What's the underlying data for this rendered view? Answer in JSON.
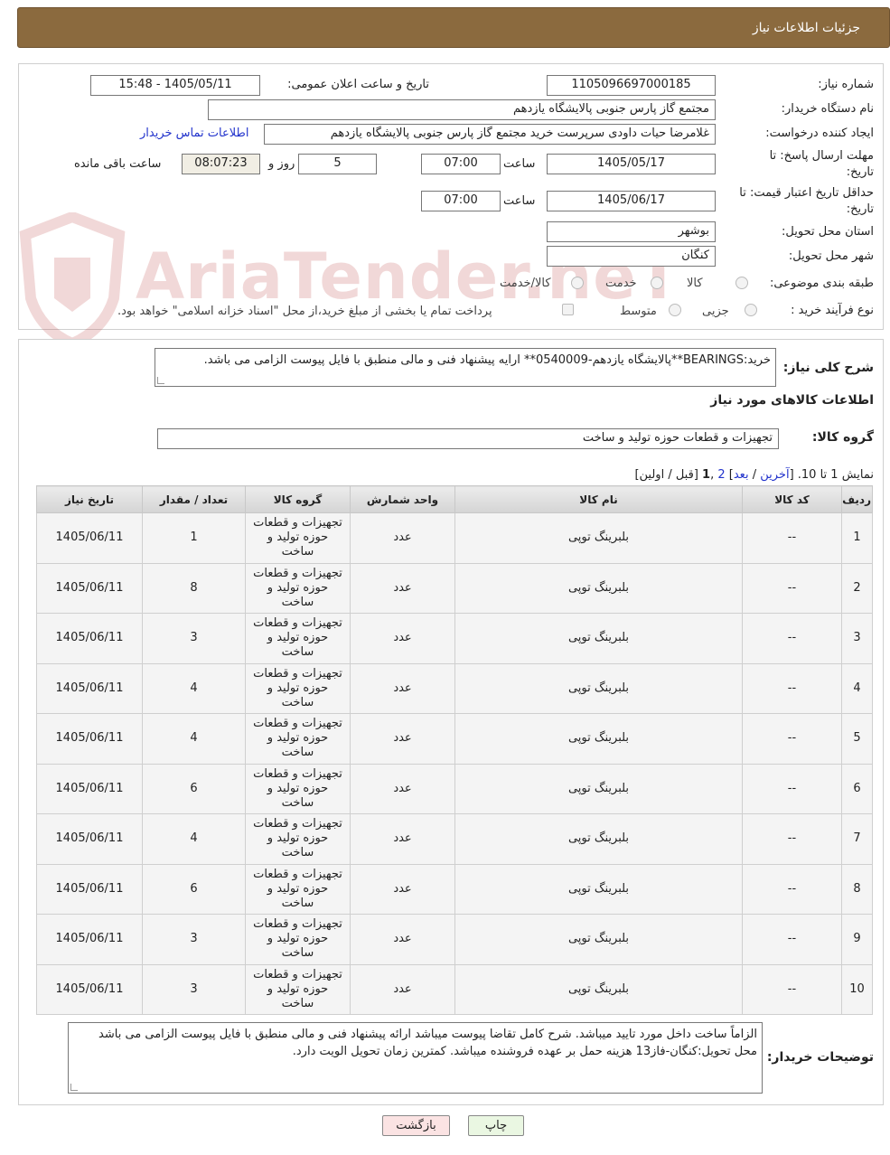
{
  "header": {
    "title": "جزئیات اطلاعات نیاز"
  },
  "general": {
    "need_number_label": "شماره نیاز:",
    "need_number": "1105096697000185",
    "announce_label": "تاریخ و ساعت اعلان عمومی:",
    "announce_value": "1405/05/11 - 15:48",
    "buyer_org_label": "نام دستگاه خریدار:",
    "buyer_org": "مجتمع گاز پارس جنوبی  پالایشگاه یازدهم",
    "requester_label": "ایجاد کننده درخواست:",
    "requester": "غلامرضا حیات داودی سرپرست خرید مجتمع گاز پارس جنوبی  پالایشگاه یازدهم",
    "contact_link": "اطلاعات تماس خریدار",
    "deadline_label_1": "مهلت ارسال پاسخ: تا",
    "deadline_label_2": "تاریخ:",
    "deadline_date": "1405/05/17",
    "time_label": "ساعت",
    "deadline_time": "07:00",
    "days_value": "5",
    "days_label": "روز و",
    "remaining_time": "08:07:23",
    "remaining_label": "ساعت باقی مانده",
    "validity_label_1": "حداقل تاریخ اعتبار قیمت: تا",
    "validity_label_2": "تاریخ:",
    "validity_date": "1405/06/17",
    "validity_time_label": "ساعت",
    "validity_time": "07:00",
    "province_label": "استان محل تحویل:",
    "province": "بوشهر",
    "city_label": "شهر محل تحویل:",
    "city": "کنگان",
    "category_label": "طبقه بندی موضوعی:",
    "category_options": [
      "کالا",
      "خدمت",
      "کالا/خدمت"
    ],
    "process_label": "نوع فرآیند خرید :",
    "process_options": [
      "جزیی",
      "متوسط"
    ],
    "payment_note": "پرداخت تمام یا بخشی از مبلغ خرید،از محل \"اسناد خزانه اسلامی\" خواهد بود."
  },
  "watermark": {
    "text": "AriaTender.neT"
  },
  "details": {
    "summary_label": "شرح کلی نیاز:",
    "summary": "خرید:BEARINGS**پالایشگاه یازدهم-0540009** ارایه پیشنهاد فنی و مالی منطبق با فایل پیوست الزامی می باشد.",
    "goods_info_title": "اطلاعات کالاهای مورد نیاز",
    "goods_group_label": "گروه کالا:",
    "goods_group": "تجهیزات و قطعات حوزه تولید و ساخت",
    "pager_prefix": "نمایش 1 تا 10. [",
    "pager_last": "آخرین",
    "pager_sep1": " / ",
    "pager_next": "بعد",
    "pager_sep2": "] ",
    "pager_page2": "2",
    "pager_sep3": " ,",
    "pager_page1": "1",
    "pager_suffix": " [قبل / اولین]"
  },
  "table": {
    "headers": [
      "ردیف",
      "کد کالا",
      "نام کالا",
      "واحد شمارش",
      "گروه کالا",
      "تعداد / مقدار",
      "تاریخ نیاز"
    ],
    "rows": [
      {
        "row": "1",
        "code": "--",
        "name": "بلبرینگ توپی",
        "unit": "عدد",
        "group": "تجهیزات و قطعات حوزه تولید و ساخت",
        "qty": "1",
        "date": "1405/06/11"
      },
      {
        "row": "2",
        "code": "--",
        "name": "بلبرینگ توپی",
        "unit": "عدد",
        "group": "تجهیزات و قطعات حوزه تولید و ساخت",
        "qty": "8",
        "date": "1405/06/11"
      },
      {
        "row": "3",
        "code": "--",
        "name": "بلبرینگ توپی",
        "unit": "عدد",
        "group": "تجهیزات و قطعات حوزه تولید و ساخت",
        "qty": "3",
        "date": "1405/06/11"
      },
      {
        "row": "4",
        "code": "--",
        "name": "بلبرینگ توپی",
        "unit": "عدد",
        "group": "تجهیزات و قطعات حوزه تولید و ساخت",
        "qty": "4",
        "date": "1405/06/11"
      },
      {
        "row": "5",
        "code": "--",
        "name": "بلبرینگ توپی",
        "unit": "عدد",
        "group": "تجهیزات و قطعات حوزه تولید و ساخت",
        "qty": "4",
        "date": "1405/06/11"
      },
      {
        "row": "6",
        "code": "--",
        "name": "بلبرینگ توپی",
        "unit": "عدد",
        "group": "تجهیزات و قطعات حوزه تولید و ساخت",
        "qty": "6",
        "date": "1405/06/11"
      },
      {
        "row": "7",
        "code": "--",
        "name": "بلبرینگ توپی",
        "unit": "عدد",
        "group": "تجهیزات و قطعات حوزه تولید و ساخت",
        "qty": "4",
        "date": "1405/06/11"
      },
      {
        "row": "8",
        "code": "--",
        "name": "بلبرینگ توپی",
        "unit": "عدد",
        "group": "تجهیزات و قطعات حوزه تولید و ساخت",
        "qty": "6",
        "date": "1405/06/11"
      },
      {
        "row": "9",
        "code": "--",
        "name": "بلبرینگ توپی",
        "unit": "عدد",
        "group": "تجهیزات و قطعات حوزه تولید و ساخت",
        "qty": "3",
        "date": "1405/06/11"
      },
      {
        "row": "10",
        "code": "--",
        "name": "بلبرینگ توپی",
        "unit": "عدد",
        "group": "تجهیزات و قطعات حوزه تولید و ساخت",
        "qty": "3",
        "date": "1405/06/11"
      }
    ]
  },
  "buyer_notes": {
    "label": "توضیحات خریدار:",
    "text": "الزاماً ساخت داخل مورد تایید میباشد. شرح کامل تقاضا پیوست میباشد ارائه پیشنهاد فنی و مالی منطبق با فایل پیوست الزامی می باشد محل تحویل:کنگان-فاز13 هزینه حمل بر عهده فروشنده میباشد. کمترین زمان تحویل الویت دارد."
  },
  "buttons": {
    "print": "چاپ",
    "back": "بازگشت",
    "print_color": "#eaf7e2",
    "back_color": "#fbe3e3"
  }
}
